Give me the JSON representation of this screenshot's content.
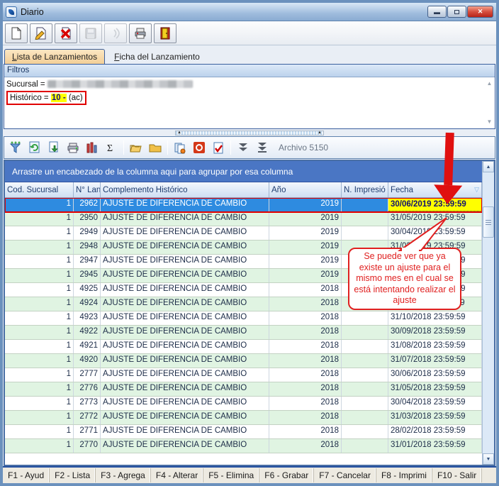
{
  "window": {
    "title": "Diario",
    "controls": {
      "minimize": "minimize",
      "maximize": "maximize",
      "close": "close"
    }
  },
  "toolbar": {
    "buttons": [
      {
        "icon": "new-document",
        "disabled": false
      },
      {
        "icon": "edit-document",
        "disabled": false
      },
      {
        "icon": "delete-document",
        "disabled": false
      },
      {
        "icon": "save",
        "disabled": true
      },
      {
        "icon": "transmit",
        "disabled": true
      },
      {
        "icon": "print",
        "disabled": false
      },
      {
        "icon": "exit-door",
        "disabled": false
      }
    ]
  },
  "tabs": [
    {
      "label": "Lista de Lanzamientos",
      "underline": "L",
      "active": true
    },
    {
      "label": "Ficha del Lanzamiento",
      "underline": "F",
      "active": false
    }
  ],
  "filters": {
    "header": "Filtros",
    "sucursal_label": "Sucursal =",
    "sucursal_value": "(redactado)",
    "historico_label": "Histórico =",
    "historico_highlight": "10 -",
    "historico_rest": "(ac)"
  },
  "grid_toolbar": {
    "items": [
      {
        "icon": "filter-funnel"
      },
      {
        "icon": "refresh"
      },
      {
        "icon": "export-down"
      },
      {
        "icon": "print-small"
      },
      {
        "icon": "columns"
      },
      {
        "icon": "sum-sigma"
      },
      {
        "icon": "separator"
      },
      {
        "icon": "open-folder"
      },
      {
        "icon": "closed-folder"
      },
      {
        "icon": "separator"
      },
      {
        "icon": "copy-documents"
      },
      {
        "icon": "record-stop"
      },
      {
        "icon": "check-document"
      },
      {
        "icon": "separator"
      },
      {
        "icon": "move-down"
      },
      {
        "icon": "move-bottom"
      }
    ],
    "caption": "Archivo 5150"
  },
  "grid": {
    "group_hint": "Arrastre un encabezado de la columna aqui para agrupar por esa columna",
    "columns": [
      "Cod. Sucursal",
      "N° Lan",
      "Complemento Histórico",
      "Año",
      "N. Impresió",
      "Fecha"
    ],
    "selected_row_index": 0,
    "highlighted_cell": {
      "row": 0,
      "column": "Fecha",
      "color": "#ffff00"
    },
    "rows": [
      [
        "1",
        "2962",
        "AJUSTE DE DIFERENCIA DE CAMBIO",
        "2019",
        "",
        "30/06/2019 23:59:59"
      ],
      [
        "1",
        "2950",
        "AJUSTE DE DIFERENCIA DE CAMBIO",
        "2019",
        "",
        "31/05/2019 23:59:59"
      ],
      [
        "1",
        "2949",
        "AJUSTE DE DIFERENCIA DE CAMBIO",
        "2019",
        "",
        "30/04/2019 23:59:59"
      ],
      [
        "1",
        "2948",
        "AJUSTE DE DIFERENCIA DE CAMBIO",
        "2019",
        "",
        "31/03/2019 23:59:59"
      ],
      [
        "1",
        "2947",
        "AJUSTE DE DIFERENCIA DE CAMBIO",
        "2019",
        "",
        "28/02/2019 23:59:59"
      ],
      [
        "1",
        "2945",
        "AJUSTE DE DIFERENCIA DE CAMBIO",
        "2019",
        "",
        "31/01/2019 23:59:59"
      ],
      [
        "1",
        "4925",
        "AJUSTE DE DIFERENCIA DE CAMBIO",
        "2018",
        "",
        "31/12/2018 23:59:59"
      ],
      [
        "1",
        "4924",
        "AJUSTE DE DIFERENCIA DE CAMBIO",
        "2018",
        "",
        "30/11/2018 23:59:59"
      ],
      [
        "1",
        "4923",
        "AJUSTE DE DIFERENCIA DE CAMBIO",
        "2018",
        "",
        "31/10/2018 23:59:59"
      ],
      [
        "1",
        "4922",
        "AJUSTE DE DIFERENCIA DE CAMBIO",
        "2018",
        "",
        "30/09/2018 23:59:59"
      ],
      [
        "1",
        "4921",
        "AJUSTE DE DIFERENCIA DE CAMBIO",
        "2018",
        "",
        "31/08/2018 23:59:59"
      ],
      [
        "1",
        "4920",
        "AJUSTE DE DIFERENCIA DE CAMBIO",
        "2018",
        "",
        "31/07/2018 23:59:59"
      ],
      [
        "1",
        "2777",
        "AJUSTE DE DIFERENCIA DE CAMBIO",
        "2018",
        "",
        "30/06/2018 23:59:59"
      ],
      [
        "1",
        "2776",
        "AJUSTE DE DIFERENCIA DE CAMBIO",
        "2018",
        "",
        "31/05/2018 23:59:59"
      ],
      [
        "1",
        "2773",
        "AJUSTE DE DIFERENCIA DE CAMBIO",
        "2018",
        "",
        "30/04/2018 23:59:59"
      ],
      [
        "1",
        "2772",
        "AJUSTE DE DIFERENCIA DE CAMBIO",
        "2018",
        "",
        "31/03/2018 23:59:59"
      ],
      [
        "1",
        "2771",
        "AJUSTE DE DIFERENCIA DE CAMBIO",
        "2018",
        "",
        "28/02/2018 23:59:59"
      ],
      [
        "1",
        "2770",
        "AJUSTE DE DIFERENCIA DE CAMBIO",
        "2018",
        "",
        "31/01/2018 23:59:59"
      ]
    ]
  },
  "callout": {
    "text": "Se puede ver que ya existe un ajuste para el mismo mes en el cual se está intentando realizar el ajuste"
  },
  "function_bar": {
    "items": [
      "F1 - Ayud",
      "F2 - Lista",
      "F3 - Agrega",
      "F4 - Alterar",
      "F5 - Elimina",
      "F6 - Grabar",
      "F7 - Cancelar",
      "F8 - Imprimi",
      "F10 - Salir"
    ]
  },
  "colors": {
    "accent_red": "#e00000",
    "highlight_yellow": "#ffff00",
    "selected_row_blue": "#2e8be0",
    "row_alt_green": "#e0f4e2",
    "group_bar_blue": "#4a76c4"
  }
}
